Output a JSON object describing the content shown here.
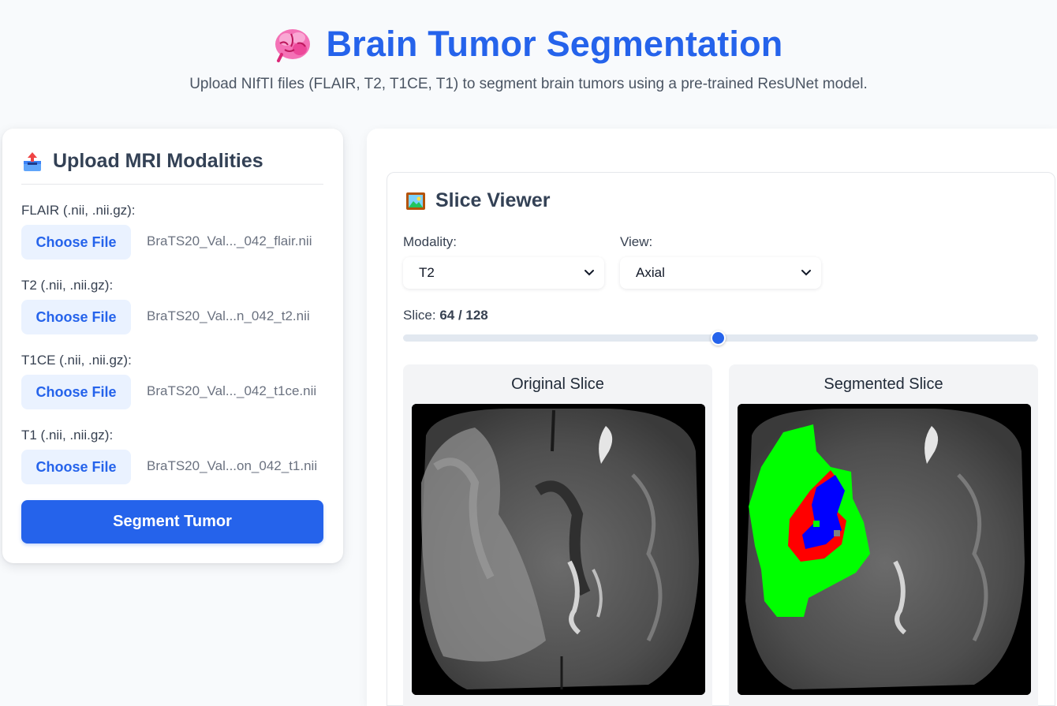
{
  "header": {
    "title": "Brain Tumor Segmentation",
    "subtitle": "Upload NIfTI files (FLAIR, T2, T1CE, T1) to segment brain tumors using a pre-trained ResUNet model.",
    "icon": "brain-icon"
  },
  "upload": {
    "title": "Upload MRI Modalities",
    "icon": "inbox-upload-icon",
    "fields": [
      {
        "label": "FLAIR (.nii, .nii.gz):",
        "button": "Choose File",
        "file": "BraTS20_Val..._042_flair.nii"
      },
      {
        "label": "T2 (.nii, .nii.gz):",
        "button": "Choose File",
        "file": "BraTS20_Val...n_042_t2.nii"
      },
      {
        "label": "T1CE (.nii, .nii.gz):",
        "button": "Choose File",
        "file": "BraTS20_Val..._042_t1ce.nii"
      },
      {
        "label": "T1 (.nii, .nii.gz):",
        "button": "Choose File",
        "file": "BraTS20_Val...on_042_t1.nii"
      }
    ],
    "submit": "Segment Tumor"
  },
  "viewer": {
    "title": "Slice Viewer",
    "icon": "picture-icon",
    "modality_label": "Modality:",
    "modality_value": "T2",
    "view_label": "View:",
    "view_value": "Axial",
    "slice_label": "Slice:",
    "slice_value": "64 / 128",
    "slice_current": 64,
    "slice_total": 128,
    "original_title": "Original Slice",
    "segmented_title": "Segmented Slice"
  },
  "colors": {
    "accent": "#2563eb",
    "segment_edema": "#00ff00",
    "segment_core": "#ff0000",
    "segment_enhancing": "#0000ff"
  }
}
